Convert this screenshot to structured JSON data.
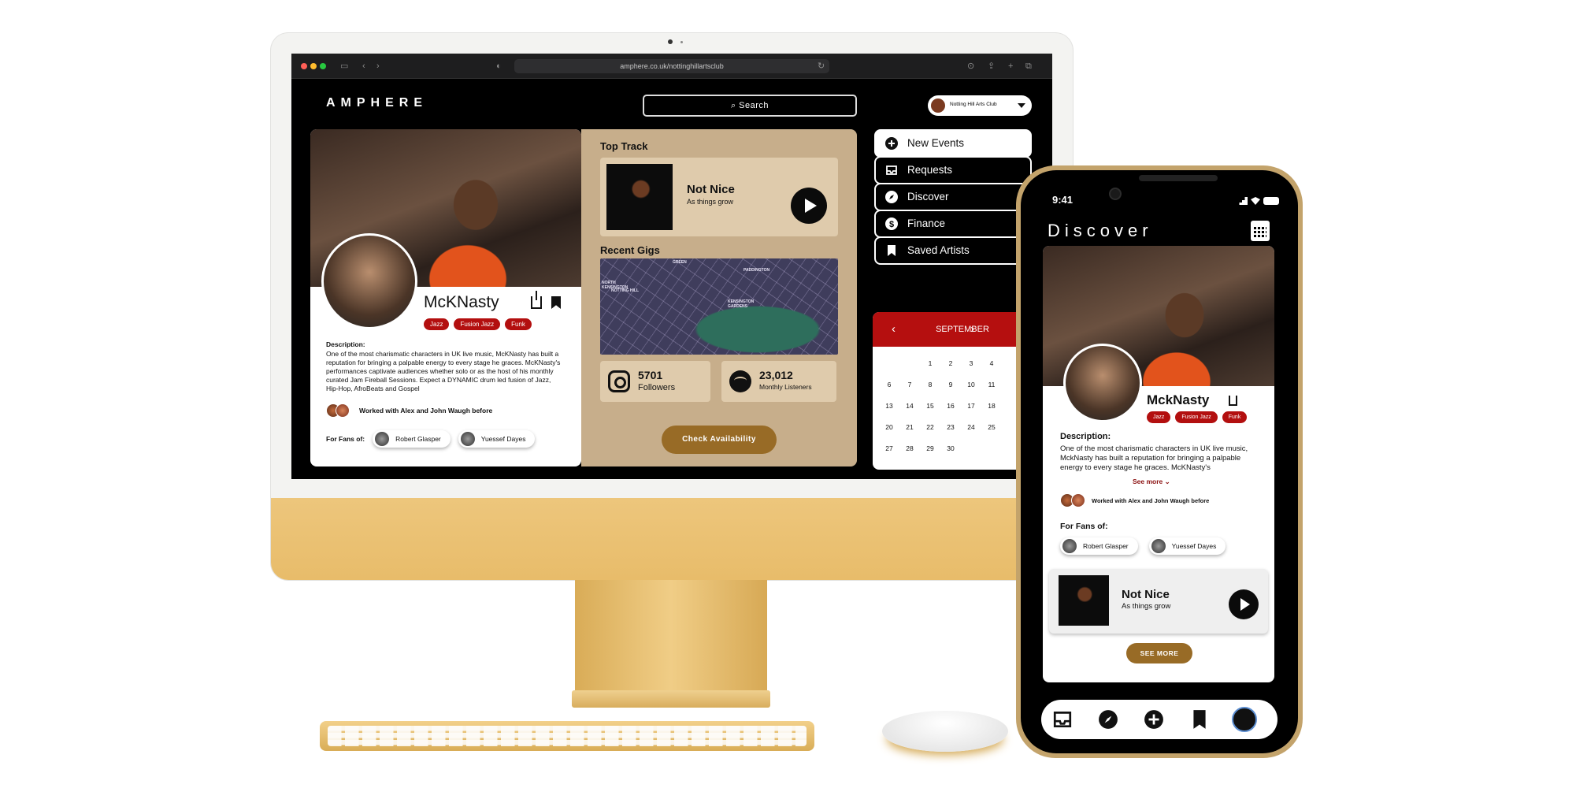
{
  "colors": {
    "accent_red": "#b30f0f",
    "accent_gold": "#986b26",
    "panel_tan": "#c7ae8b",
    "device_gold": "#e8bc6a"
  },
  "browser": {
    "url": "amphere.co.uk/nottinghillartsclub"
  },
  "desktop": {
    "logo": "AMPHERE",
    "search_placeholder": "Search",
    "account_name": "Notting Hill Arts Club",
    "artist": {
      "name": "McKNasty",
      "tags": [
        "Jazz",
        "Fusion Jazz",
        "Funk"
      ],
      "description_label": "Description:",
      "description": "One of the most charismatic characters in UK live music, McKNasty has built a reputation for bringing a palpable energy to every stage he graces. McKNasty's performances captivate audiences whether solo or as the host of his monthly curated Jam Fireball Sessions. Expect a DYNAMIC drum led fusion of Jazz, Hip-Hop, AfroBeats and Gospel",
      "worked_with": "Worked with Alex and John Waugh before",
      "fans_label": "For Fans of:",
      "fans": [
        "Robert Glasper",
        "Yuessef Dayes"
      ]
    },
    "top_track": {
      "heading": "Top Track",
      "title": "Not Nice",
      "subtitle": "As things grow"
    },
    "recent_gigs": {
      "heading": "Recent Gigs",
      "map_labels": [
        "GREEN",
        "PADDINGTON",
        "NORTH KENSINGTON",
        "NOTTING HILL",
        "KENSINGTON GARDENS"
      ]
    },
    "stats": {
      "instagram_count": "5701",
      "instagram_label": "Followers",
      "spotify_count": "23,012",
      "spotify_label": "Monthly Listeners"
    },
    "check_button": "Check Availability",
    "nav": [
      {
        "label": "New Events",
        "icon": "plus-circle-icon",
        "active": true
      },
      {
        "label": "Requests",
        "icon": "inbox-icon",
        "active": false
      },
      {
        "label": "Discover",
        "icon": "compass-icon",
        "active": false
      },
      {
        "label": "Finance",
        "icon": "dollar-icon",
        "active": false
      },
      {
        "label": "Saved Artists",
        "icon": "bookmark-icon",
        "active": false
      }
    ],
    "calendar": {
      "month": "SEPTEMBER",
      "weeks": [
        [
          "",
          "",
          "1",
          "2",
          "3",
          "4",
          ""
        ],
        [
          "6",
          "7",
          "8",
          "9",
          "10",
          "11",
          ""
        ],
        [
          "13",
          "14",
          "15",
          "16",
          "17",
          "18",
          ""
        ],
        [
          "20",
          "21",
          "22",
          "23",
          "24",
          "25",
          ""
        ],
        [
          "27",
          "28",
          "29",
          "30",
          "",
          "",
          ""
        ]
      ]
    }
  },
  "phone": {
    "time": "9:41",
    "title": "Discover",
    "artist_name": "MckNasty",
    "tags": [
      "Jazz",
      "Fusion Jazz",
      "Funk"
    ],
    "description_label": "Description:",
    "description": "One of the most charismatic characters in UK live music, MckNasty has built a reputation for bringing a palpable energy to every stage he graces. McKNasty's",
    "see_more": "See more",
    "worked_with": "Worked with Alex and John Waugh before",
    "fans_label": "For Fans of:",
    "fans": [
      "Robert Glasper",
      "Yuessef Dayes"
    ],
    "track_title": "Not Nice",
    "track_subtitle": "As things grow",
    "see_more_button": "SEE MORE",
    "tabs": [
      "inbox-icon",
      "compass-icon",
      "plus-circle-icon",
      "bookmark-icon",
      "profile-avatar"
    ]
  }
}
